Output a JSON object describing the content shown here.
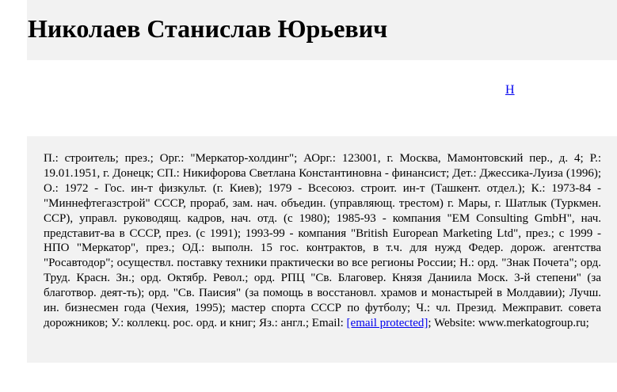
{
  "profile": {
    "name": "Николаев Станислав Юрьевич",
    "index_letter": "Н",
    "bio_before_email": "П.: строитель; през.; Орг.: \"Меркатор-холдинг\"; АОрг.: 123001, г. Москва, Мамонтовский пер., д. 4; Р.: 19.01.1951, г. Донецк; СП.: Никифорова Светлана Константиновна - финансист; Дет.: Джессика-Луиза (1996); О.: 1972 - Гос. ин-т физкульт. (г. Киев); 1979 - Всесоюз. строит. ин-т (Ташкент. отдел.); К.: 1973-84 - \"Миннефтегазстрой\" СССР, прораб, зам. нач. объедин. (управляющ. трестом) г. Мары, г. Шатлык (Туркмен. ССР), управл. руководящ. кадров, нач. отд. (с 1980); 1985-93 - компания \"EM Consulting GmbH\", нач. представит-ва в СССР, през. (с 1991); 1993-99 - компания \"British European Marketing Ltd\", през.; с 1999 - НПО \"Меркатор\", през.; ОД.: выполн. 15 гос. контрактов, в т.ч. для нужд Федер. дорож. агентства \"Росавтодор\"; осуществл. поставку техники практически во все регионы России; Н.: орд. \"Знак Почета\"; орд. Труд. Красн. Зн.; орд. Октябр. Револ.; орд. РПЦ \"Св. Благовер. Князя Даниила Моск. 3-й степени\" (за благотвор. деят-ть); орд. \"Св. Паисия\" (за помощь в восстановл. храмов и монастырей в Молдавии); Лучш. ин. бизнесмен года (Чехия, 1995); мастер спорта СССР по футболу; Ч.: чл. Презид. Межправит. совета дорожников; У.: коллекц. рос. орд. и книг; Яз.: англ.; Email: ",
    "email_link": "[email protected]",
    "bio_after_email": "; Website: www.merkatogroup.ru;"
  }
}
